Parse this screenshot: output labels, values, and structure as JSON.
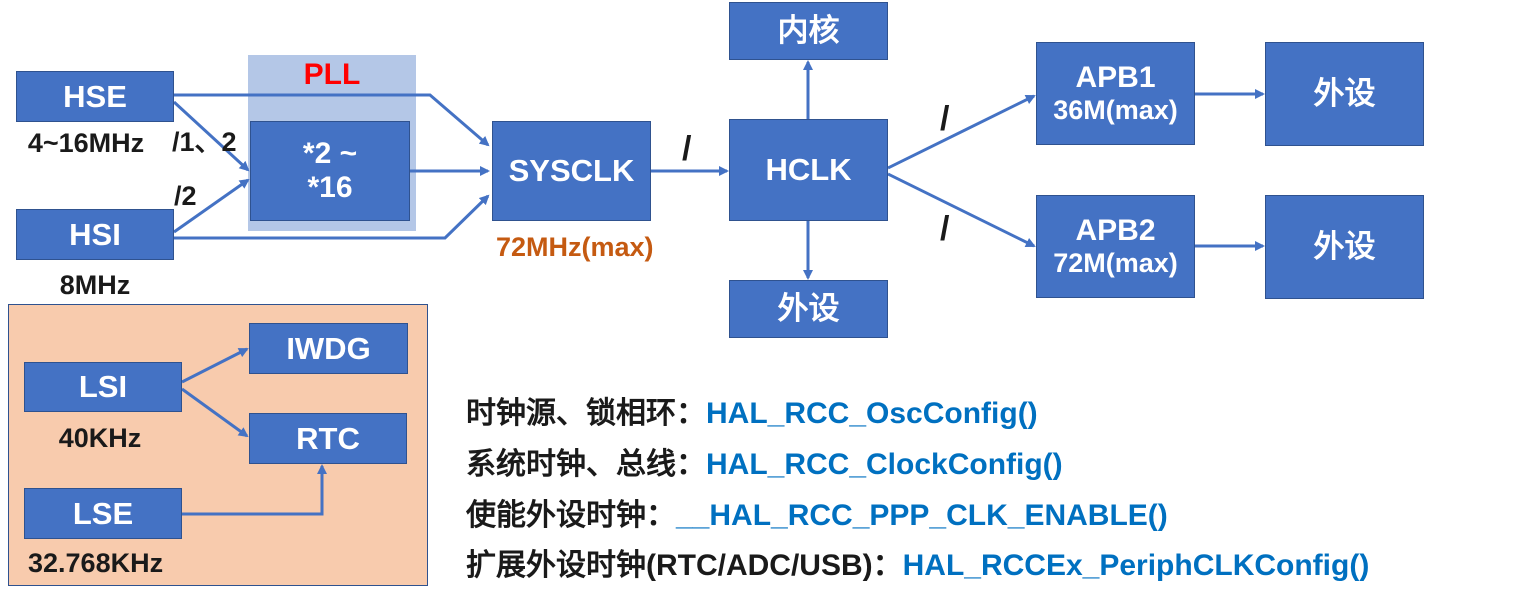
{
  "diagram": {
    "pll_title": "PLL",
    "pll_multiplier": "*2 ~ *16",
    "hse": {
      "label": "HSE",
      "freq": "4~16MHz"
    },
    "hsi": {
      "label": "HSI",
      "freq": "8MHz"
    },
    "div_hse": "/1、2",
    "div_hsi": "/2",
    "sysclk": {
      "label": "SYSCLK",
      "freq": "72MHz(max)"
    },
    "div_sys": "/",
    "hclk": "HCLK",
    "core": "内核",
    "periph": "外设",
    "div_apb1": "/",
    "div_apb2": "/",
    "apb1": {
      "label": "APB1",
      "freq": "36M(max)"
    },
    "apb2": {
      "label": "APB2",
      "freq": "72M(max)"
    },
    "apb1_periph": "外设",
    "apb2_periph": "外设",
    "lsi": {
      "label": "LSI",
      "freq": "40KHz"
    },
    "lse": {
      "label": "LSE",
      "freq": "32.768KHz"
    },
    "iwdg": "IWDG",
    "rtc": "RTC"
  },
  "api_list": [
    {
      "desc": "时钟源、锁相环：",
      "func": "HAL_RCC_OscConfig()"
    },
    {
      "desc": "系统时钟、总线：",
      "func": "HAL_RCC_ClockConfig()"
    },
    {
      "desc": "使能外设时钟：",
      "func": "__HAL_RCC_PPP_CLK_ENABLE()"
    },
    {
      "desc": "扩展外设时钟(RTC/ADC/USB)：",
      "func": "HAL_RCCEx_PeriphCLKConfig()"
    }
  ],
  "colors": {
    "box_fill": "#4472c4",
    "box_border": "#2f528f",
    "pll_title": "#ff0000",
    "sysclk_freq": "#c55a11",
    "lsi_panel": "#f8cbad",
    "pll_panel": "#b4c7e7",
    "api_func": "#0070c0"
  }
}
